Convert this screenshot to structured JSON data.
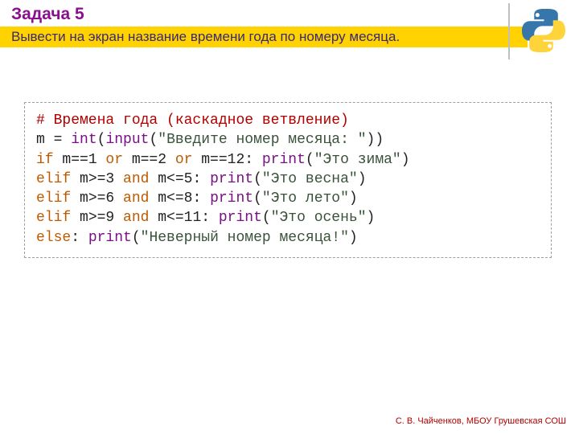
{
  "header": {
    "title": "Задача 5",
    "subtitle": "Вывести на экран название времени года по номеру месяца."
  },
  "code": {
    "comment": "# Времена года (каскадное ветвление)",
    "l2_a": "m = ",
    "l2_int": "int",
    "l2_b": "(",
    "l2_input": "input",
    "l2_c": "(",
    "l2_str": "\"Введите номер месяца: \"",
    "l2_d": "))",
    "l3_if": "if",
    "l3_a": " m==1 ",
    "l3_or1": "or",
    "l3_b": " m==2 ",
    "l3_or2": "or",
    "l3_c": " m==12: ",
    "l3_print": "print",
    "l3_d": "(",
    "l3_str": "\"Это зима\"",
    "l3_e": ")",
    "l4_elif": "elif",
    "l4_a": " m>=3 ",
    "l4_and": "and",
    "l4_b": " m<=5: ",
    "l4_print": "print",
    "l4_c": "(",
    "l4_str": "\"Это весна\"",
    "l4_d": ")",
    "l5_elif": "elif",
    "l5_a": " m>=6 ",
    "l5_and": "and",
    "l5_b": " m<=8: ",
    "l5_print": "print",
    "l5_c": "(",
    "l5_str": "\"Это лето\"",
    "l5_d": ")",
    "l6_elif": "elif",
    "l6_a": " m>=9 ",
    "l6_and": "and",
    "l6_b": " m<=11: ",
    "l6_print": "print",
    "l6_c": "(",
    "l6_str": "\"Это осень\"",
    "l6_d": ")",
    "l7_else": "else",
    "l7_a": ": ",
    "l7_print": "print",
    "l7_b": "(",
    "l7_str": "\"Неверный номер месяца!\"",
    "l7_c": ")"
  },
  "footer": "С. В. Чайченков, МБОУ Грушевская СОШ"
}
